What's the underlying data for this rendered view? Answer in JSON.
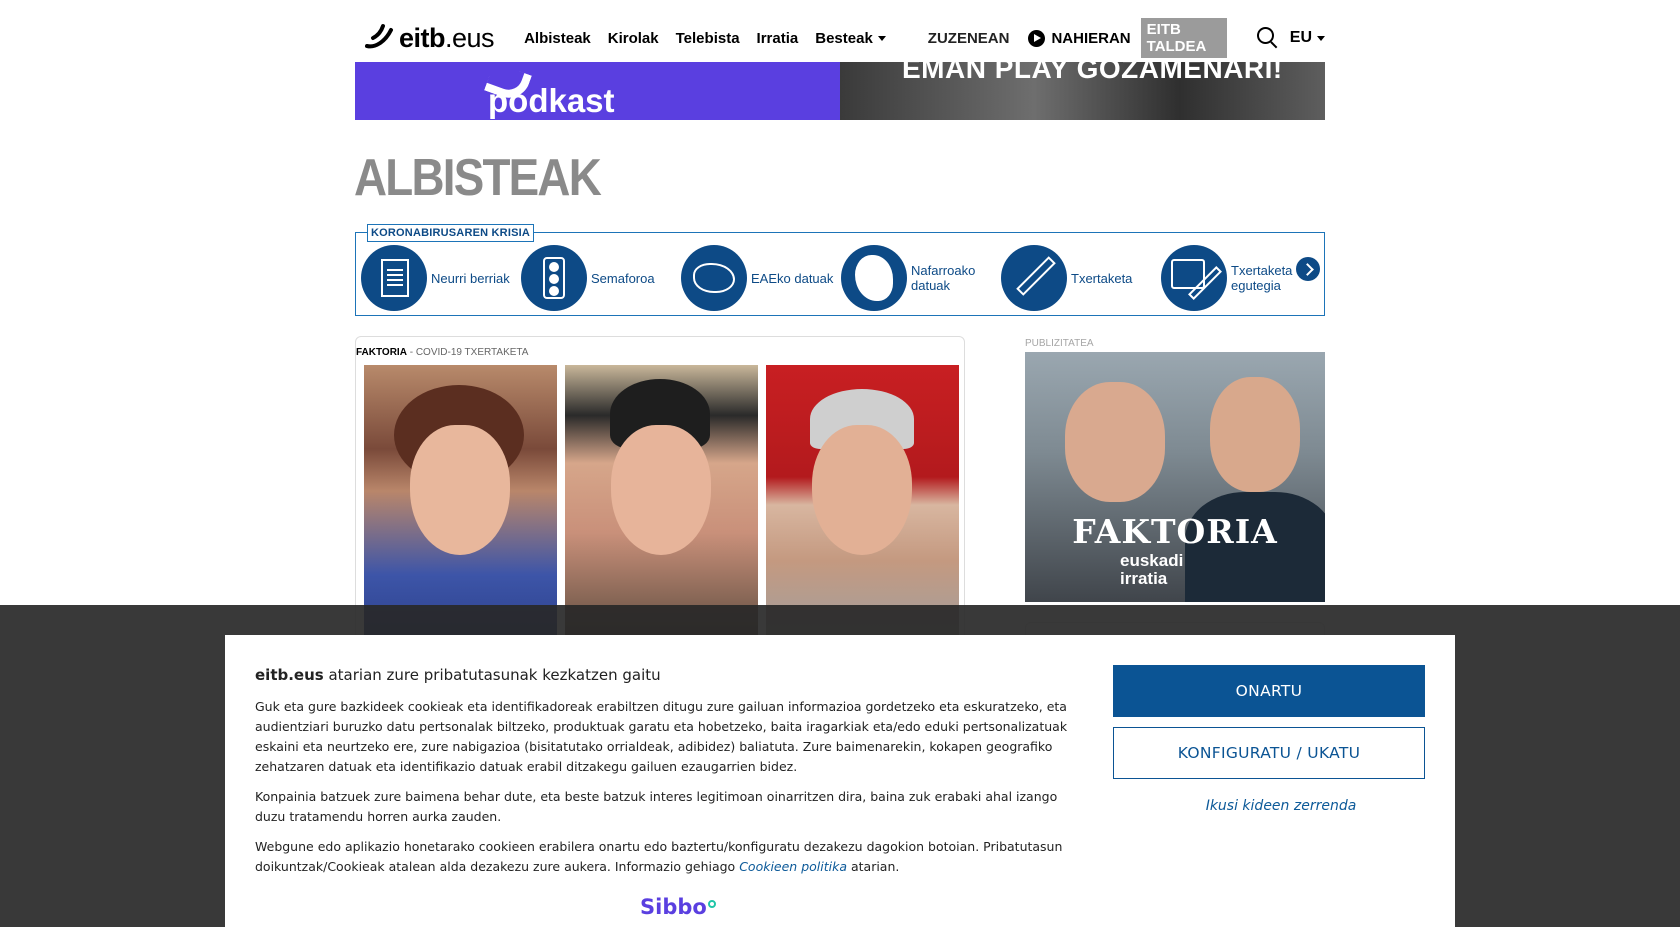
{
  "header": {
    "logo": {
      "bold": "eitb",
      "rest": ".eus",
      "icon": "eitb-logo-icon"
    },
    "menu": [
      "Albisteak",
      "Kirolak",
      "Telebista",
      "Irratia",
      "Besteak"
    ],
    "zuzenean": "ZUZENEAN",
    "nahieran": "NAHIERAN",
    "taldea": "EITB TALDEA",
    "lang": "EU"
  },
  "banner": {
    "left_text": "podkast",
    "right_text": "EMAN PLAY GOZAMENARI!",
    "left_color": "#5a3fe0"
  },
  "page_title": "ALBISTEAK",
  "corona": {
    "tag": "KORONABIRUSAREN KRISIA",
    "items": [
      {
        "label": "Neurri berriak",
        "icon": "document-icon"
      },
      {
        "label": "Semaforoa",
        "icon": "traffic-light-icon"
      },
      {
        "label": "EAEko datuak",
        "icon": "basque-map-icon"
      },
      {
        "label": "Nafarroako datuak",
        "icon": "navarre-map-icon"
      },
      {
        "label": "Txertaketa",
        "icon": "syringe-icon"
      },
      {
        "label": "Txertaketa egutegia",
        "icon": "calendar-syringe-icon"
      }
    ],
    "accent": "#0d4a86"
  },
  "article": {
    "program": "FAKTORIA",
    "separator": " - ",
    "topic": "COVID-19 TXERTAKETA"
  },
  "sidebar": {
    "pub_label": "PUBLIZITATEA",
    "ad_title": "FAKTORIA",
    "ad_brand_line1": "euskadi",
    "ad_brand_line2": "irratia"
  },
  "cookie": {
    "title_bold": "eitb.eus",
    "title_rest": " atarian zure pribatutasunak kezkatzen gaitu",
    "p1": "Guk eta gure bazkideek cookieak eta identifikadoreak erabiltzen ditugu zure gailuan informazioa gordetzeko eta eskuratzeko, eta audientziari buruzko datu pertsonalak biltzeko, produktuak garatu eta hobetzeko, baita iragarkiak eta/edo eduki pertsonalizatuak eskaini eta neurtzeko ere, zure nabigazioa (bisitatutako orrialdeak, adibidez) baliatuta. Zure baimenarekin, kokapen geografiko zehatzaren datuak eta identifikazio datuak erabil ditzakegu gailuen ezaugarrien bidez.",
    "p2": "Konpainia batzuek zure baimena behar dute, eta beste batzuk interes legitimoan oinarritzen dira, baina zuk erabaki ahal izango duzu tratamendu horren aurka zauden.",
    "p3_before": "Webgune edo aplikazio honetarako cookieen erabilera onartu edo baztertu/konfiguratu dezakezu dagokion botoian. Pribatutasun doikuntzak/Cookieak atalean alda dezakezu zure aukera. Informazio gehiago ",
    "p3_link": "Cookieen politika",
    "p3_after": " atarian.",
    "accept": "ONARTU",
    "configure": "KONFIGURATU / UKATU",
    "vendors": "Ikusi kideen zerrenda",
    "powered_by": "Sibbo"
  }
}
